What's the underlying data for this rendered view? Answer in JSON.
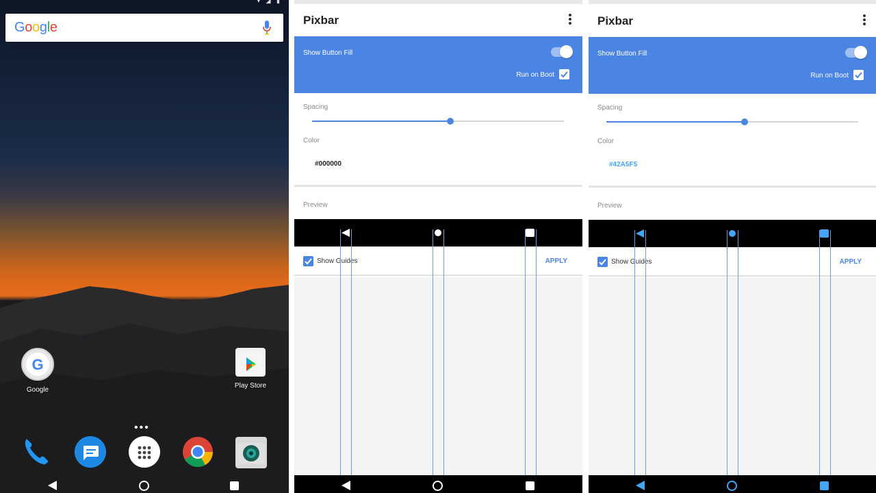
{
  "home": {
    "search": {
      "logo": "Google",
      "mic_icon": "mic-icon"
    },
    "apps": [
      {
        "label": "Google",
        "icon": "google-app-icon"
      },
      {
        "label": "Play Store",
        "icon": "play-store-icon"
      }
    ],
    "dock": [
      {
        "icon": "phone-icon"
      },
      {
        "icon": "messages-icon"
      },
      {
        "icon": "app-drawer-icon"
      },
      {
        "icon": "chrome-icon"
      },
      {
        "icon": "camera-icon"
      }
    ],
    "nav": [
      "back-icon",
      "home-icon",
      "recents-icon"
    ]
  },
  "pixbar_screens": [
    {
      "title": "Pixbar",
      "show_button_fill": "Show Button Fill",
      "show_button_fill_on": true,
      "run_on_boot": "Run on Boot",
      "run_on_boot_checked": true,
      "spacing_label": "Spacing",
      "spacing_value": 0.55,
      "color_label": "Color",
      "color_value": "#000000",
      "preview_label": "Preview",
      "show_guides": "Show Guides",
      "show_guides_checked": true,
      "apply": "APPLY",
      "preview_button_color": "#ffffff"
    },
    {
      "title": "Pixbar",
      "show_button_fill": "Show Button Fill",
      "show_button_fill_on": true,
      "run_on_boot": "Run on Boot",
      "run_on_boot_checked": true,
      "spacing_label": "Spacing",
      "spacing_value": 0.55,
      "color_label": "Color",
      "color_value": "#42A5F5",
      "preview_label": "Preview",
      "show_guides": "Show Guides",
      "show_guides_checked": true,
      "apply": "APPLY",
      "preview_button_color": "#42A5F5"
    }
  ],
  "colors": {
    "accent": "#4a85e4",
    "guide": "#6d9be8"
  }
}
